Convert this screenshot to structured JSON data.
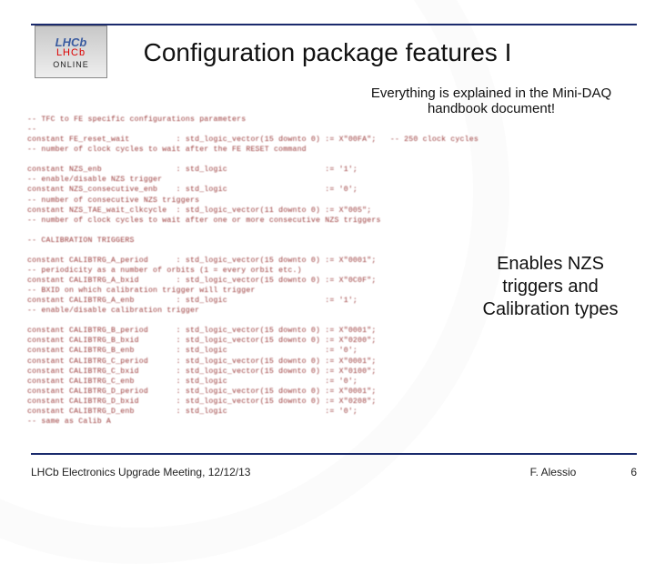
{
  "logo": {
    "line1": "LHCb",
    "line2": "LHCb",
    "line3": "ONLINE"
  },
  "title": "Configuration package features I",
  "note_top": "Everything is explained in the Mini-DAQ handbook document!",
  "callout": "Enables NZS triggers and Calibration types",
  "code_lines": [
    "-- TFC to FE specific configurations parameters",
    "--",
    "constant FE_reset_wait          : std_logic_vector(15 downto 0) := X\"00FA\";   -- 250 clock cycles",
    "-- number of clock cycles to wait after the FE RESET command",
    "",
    "constant NZS_enb                : std_logic                     := '1';",
    "-- enable/disable NZS trigger",
    "constant NZS_consecutive_enb    : std_logic                     := '0';",
    "-- number of consecutive NZS triggers",
    "constant NZS_TAE_wait_clkcycle  : std_logic_vector(11 downto 0) := X\"005\";",
    "-- number of clock cycles to wait after one or more consecutive NZS triggers",
    "",
    "-- CALIBRATION TRIGGERS",
    "",
    "constant CALIBTRG_A_period      : std_logic_vector(15 downto 0) := X\"0001\";",
    "-- periodicity as a number of orbits (1 = every orbit etc.)",
    "constant CALIBTRG_A_bxid        : std_logic_vector(15 downto 0) := X\"0C0F\";",
    "-- BXID on which calibration trigger will trigger",
    "constant CALIBTRG_A_enb         : std_logic                     := '1';",
    "-- enable/disable calibration trigger",
    "",
    "constant CALIBTRG_B_period      : std_logic_vector(15 downto 0) := X\"0001\";",
    "constant CALIBTRG_B_bxid        : std_logic_vector(15 downto 0) := X\"0200\";",
    "constant CALIBTRG_B_enb         : std_logic                     := '0';",
    "constant CALIBTRG_C_period      : std_logic_vector(15 downto 0) := X\"0001\";",
    "constant CALIBTRG_C_bxid        : std_logic_vector(15 downto 0) := X\"0100\";",
    "constant CALIBTRG_C_enb         : std_logic                     := '0';",
    "constant CALIBTRG_D_period      : std_logic_vector(15 downto 0) := X\"0001\";",
    "constant CALIBTRG_D_bxid        : std_logic_vector(15 downto 0) := X\"0208\";",
    "constant CALIBTRG_D_enb         : std_logic                     := '0';",
    "-- same as Calib A"
  ],
  "footer": {
    "left": "LHCb Electronics Upgrade Meeting, 12/12/13",
    "author": "F. Alessio",
    "page": "6"
  }
}
